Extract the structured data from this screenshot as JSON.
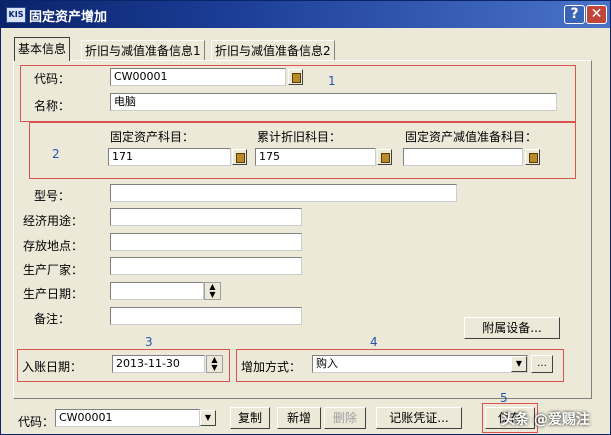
{
  "window": {
    "app_icon": "KIS",
    "title": "固定资产增加",
    "help_label": "?",
    "close_label": "✕"
  },
  "tabs": [
    {
      "label": "基本信息",
      "active": true
    },
    {
      "label": "折旧与减值准备信息1",
      "active": false
    },
    {
      "label": "折旧与减值准备信息2",
      "active": false
    }
  ],
  "annotations": [
    "1",
    "2",
    "3",
    "4",
    "5"
  ],
  "basic": {
    "code_label": "代码：",
    "code_value": "CW00001",
    "name_label": "名称：",
    "name_value": "电脑"
  },
  "accounts": {
    "asset_label": "固定资产科目：",
    "asset_value": "171",
    "dep_label": "累计折旧科目：",
    "dep_value": "175",
    "impair_label": "固定资产减值准备科目：",
    "impair_value": ""
  },
  "details": {
    "model_label": "型号：",
    "model_value": "",
    "use_label": "经济用途：",
    "use_value": "",
    "location_label": "存放地点：",
    "location_value": "",
    "maker_label": "生产厂家：",
    "maker_value": "",
    "date_label": "生产日期：",
    "date_value": "",
    "note_label": "备注：",
    "note_value": "",
    "attach_button": "附属设备..."
  },
  "entry": {
    "date_label": "入账日期：",
    "date_value": "2013-11-30",
    "method_label": "增加方式：",
    "method_value": "购入",
    "method_more": "..."
  },
  "footer": {
    "code_label": "代码：",
    "code_value": "CW00001",
    "copy_button": "复制",
    "new_button": "新增",
    "delete_button": "删除",
    "voucher_button": "记账凭证...",
    "save_button": "保存"
  },
  "watermark": "头条 @爱赐注"
}
